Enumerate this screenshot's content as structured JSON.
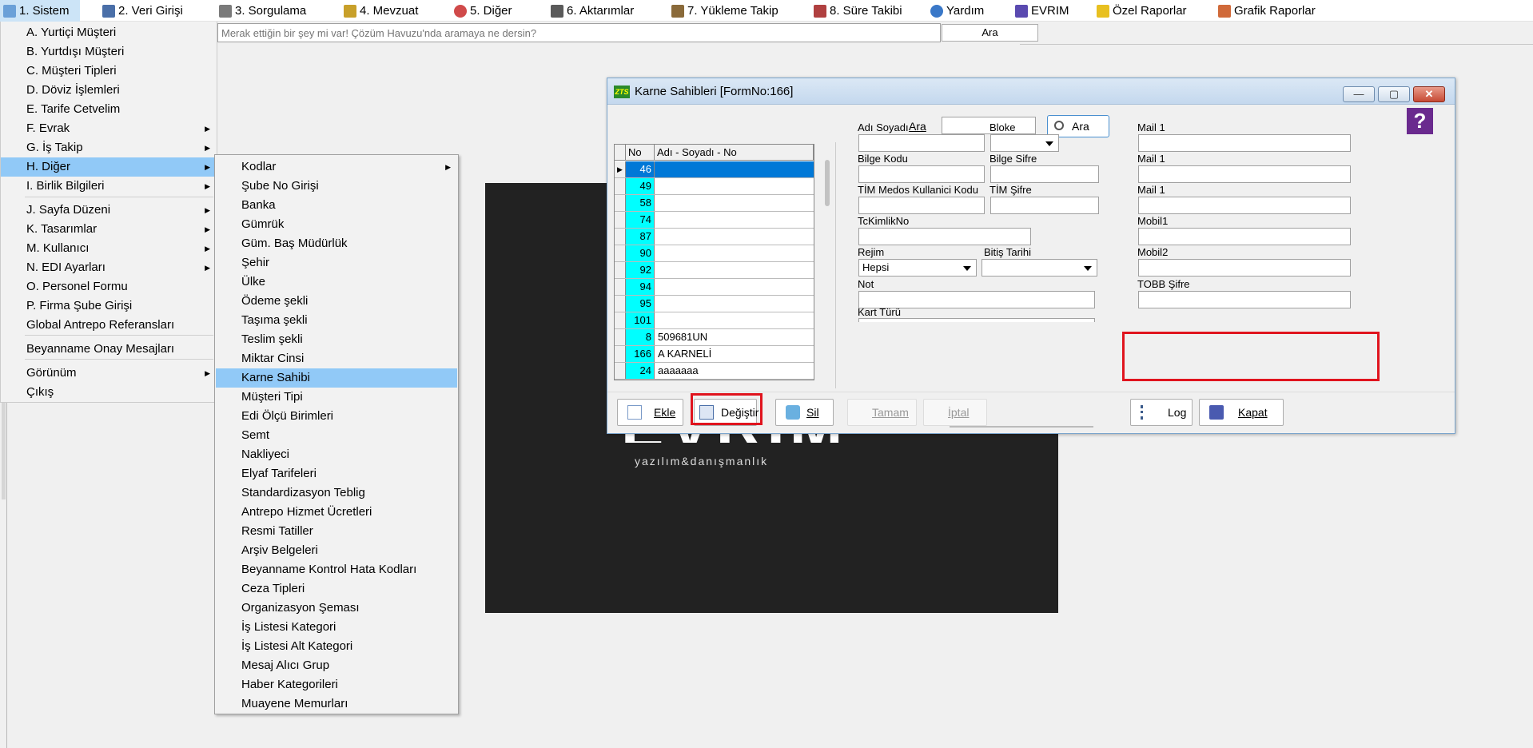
{
  "menubar": [
    {
      "label": "1.  Sistem",
      "icon": "app-icon"
    },
    {
      "label": "2.  Veri Girişi",
      "icon": "edit-icon"
    },
    {
      "label": "3.  Sorgulama",
      "icon": "query-icon"
    },
    {
      "label": "4.  Mevzuat",
      "icon": "books-icon"
    },
    {
      "label": "5.  Diğer",
      "icon": "shapes-icon"
    },
    {
      "label": "6.  Aktarımlar",
      "icon": "transfer-icon"
    },
    {
      "label": "7.  Yükleme Takip",
      "icon": "tracking-icon"
    },
    {
      "label": "8. Süre Takibi",
      "icon": "clipboard-icon"
    },
    {
      "label": "Yardım",
      "icon": "help-icon"
    },
    {
      "label": "EVRIM",
      "icon": "book-icon"
    },
    {
      "label": "Özel Raporlar",
      "icon": "star-icon"
    },
    {
      "label": "Grafik Raporlar",
      "icon": "chart-icon"
    }
  ],
  "search": {
    "placeholder": "Merak ettiğin bir şey mi var! Çözüm Havuzu'nda aramaya ne dersin?",
    "button": "Ara"
  },
  "menu_sistem": [
    {
      "label": "A.  Yurtiçi Müşteri",
      "sub": false
    },
    {
      "label": "B.  Yurtdışı Müşteri",
      "sub": false
    },
    {
      "label": "C.  Müşteri Tipleri",
      "sub": false
    },
    {
      "label": "D.  Döviz İşlemleri",
      "sub": false
    },
    {
      "label": "E.  Tarife Cetvelim",
      "sub": false
    },
    {
      "label": "F.  Evrak",
      "sub": true
    },
    {
      "label": "G.  İş Takip",
      "sub": true
    },
    {
      "label": "H.  Diğer",
      "sub": true
    },
    {
      "label": "I.  Birlik Bilgileri",
      "sub": true
    },
    {
      "label": "J.  Sayfa Düzeni",
      "sub": true
    },
    {
      "label": "K.  Tasarımlar",
      "sub": true
    },
    {
      "label": "M.  Kullanıcı",
      "sub": true
    },
    {
      "label": "N.  EDI Ayarları",
      "sub": true
    },
    {
      "label": "O.  Personel Formu",
      "sub": false
    },
    {
      "label": "P.  Firma Şube Girişi",
      "sub": false
    },
    {
      "label": "Global Antrepo Referansları",
      "sub": false
    },
    {
      "label": "Beyanname Onay Mesajları",
      "sub": false
    },
    {
      "label": "Görünüm",
      "sub": true
    },
    {
      "label": "Çıkış",
      "sub": false
    }
  ],
  "menu_diger": [
    "Kodlar",
    "Şube No Girişi",
    "Banka",
    "Gümrük",
    "Güm. Baş Müdürlük",
    "Şehir",
    "Ülke",
    "Ödeme şekli",
    "Taşıma şekli",
    "Teslim şekli",
    "Miktar Cinsi",
    "Karne Sahibi",
    "Müşteri  Tipi",
    "Edi Ölçü Birimleri",
    "Semt",
    "Nakliyeci",
    "Elyaf Tarifeleri",
    "Standardizasyon Teblig",
    "Antrepo Hizmet Ücretleri",
    "Resmi Tatiller",
    "Arşiv Belgeleri",
    "Beyanname Kontrol Hata Kodları",
    "Ceza Tipleri",
    "Organizasyon Şeması",
    "İş Listesi Kategori",
    "İş Listesi Alt Kategori",
    "Mesaj Alıcı Grup",
    "Haber Kategorileri",
    "Muayene Memurları"
  ],
  "logo": {
    "main": "EVRIM",
    "sub": "yazılım&danışmanlık"
  },
  "form": {
    "title": "Karne Sahibleri [FormNo:166]",
    "title_icon": "ZTS",
    "ara_label": "Ara",
    "ara_button": "Ara",
    "help_icon_text": "?",
    "grid": {
      "headers": [
        "No",
        "Adı - Soyadı - No"
      ],
      "rows": [
        {
          "no": "46",
          "name": ""
        },
        {
          "no": "49",
          "name": ""
        },
        {
          "no": "58",
          "name": ""
        },
        {
          "no": "74",
          "name": ""
        },
        {
          "no": "87",
          "name": ""
        },
        {
          "no": "90",
          "name": ""
        },
        {
          "no": "92",
          "name": ""
        },
        {
          "no": "94",
          "name": ""
        },
        {
          "no": "95",
          "name": ""
        },
        {
          "no": "101",
          "name": ""
        },
        {
          "no": "8",
          "name": "509681UN"
        },
        {
          "no": "166",
          "name": "A KARNELİ"
        },
        {
          "no": "24",
          "name": "aaaaaaa"
        }
      ]
    },
    "fields": {
      "adi_soyadi": "Adı Soyadı",
      "bloke": "Bloke",
      "mail1_a": "Mail 1",
      "bilge_kodu": "Bilge Kodu",
      "bilge_sifre": "Bilge Sifre",
      "mail1_b": "Mail 1",
      "tim_medos": "TİM Medos Kullanici Kodu",
      "tim_sifre": "TİM Şifre",
      "mail1_c": "Mail 1",
      "tckimlik": "TcKimlikNo",
      "mobil1": "Mobil1",
      "rejim": "Rejim",
      "rejim_value": "Hepsi",
      "bitis_tarihi": "Bitiş Tarihi",
      "mobil2": "Mobil2",
      "not": "Not",
      "tobb_sifre": "TOBB Şifre",
      "kart_turu": "Kart Türü"
    },
    "buttons": {
      "ekle": "Ekle",
      "degistir": "Değiştir",
      "sil": "Sil",
      "tamam": "Tamam",
      "iptal": "İptal",
      "log": "Log",
      "kapat": "Kapat"
    },
    "window_buttons": {
      "minimize": "—",
      "maximize": "▢",
      "close": "✕"
    }
  },
  "colors": {
    "selected_menu": "#91c9f7",
    "grid_no_cell": "#00ffff",
    "grid_selected": "#0078d7",
    "highlight_box": "#e0141e"
  }
}
